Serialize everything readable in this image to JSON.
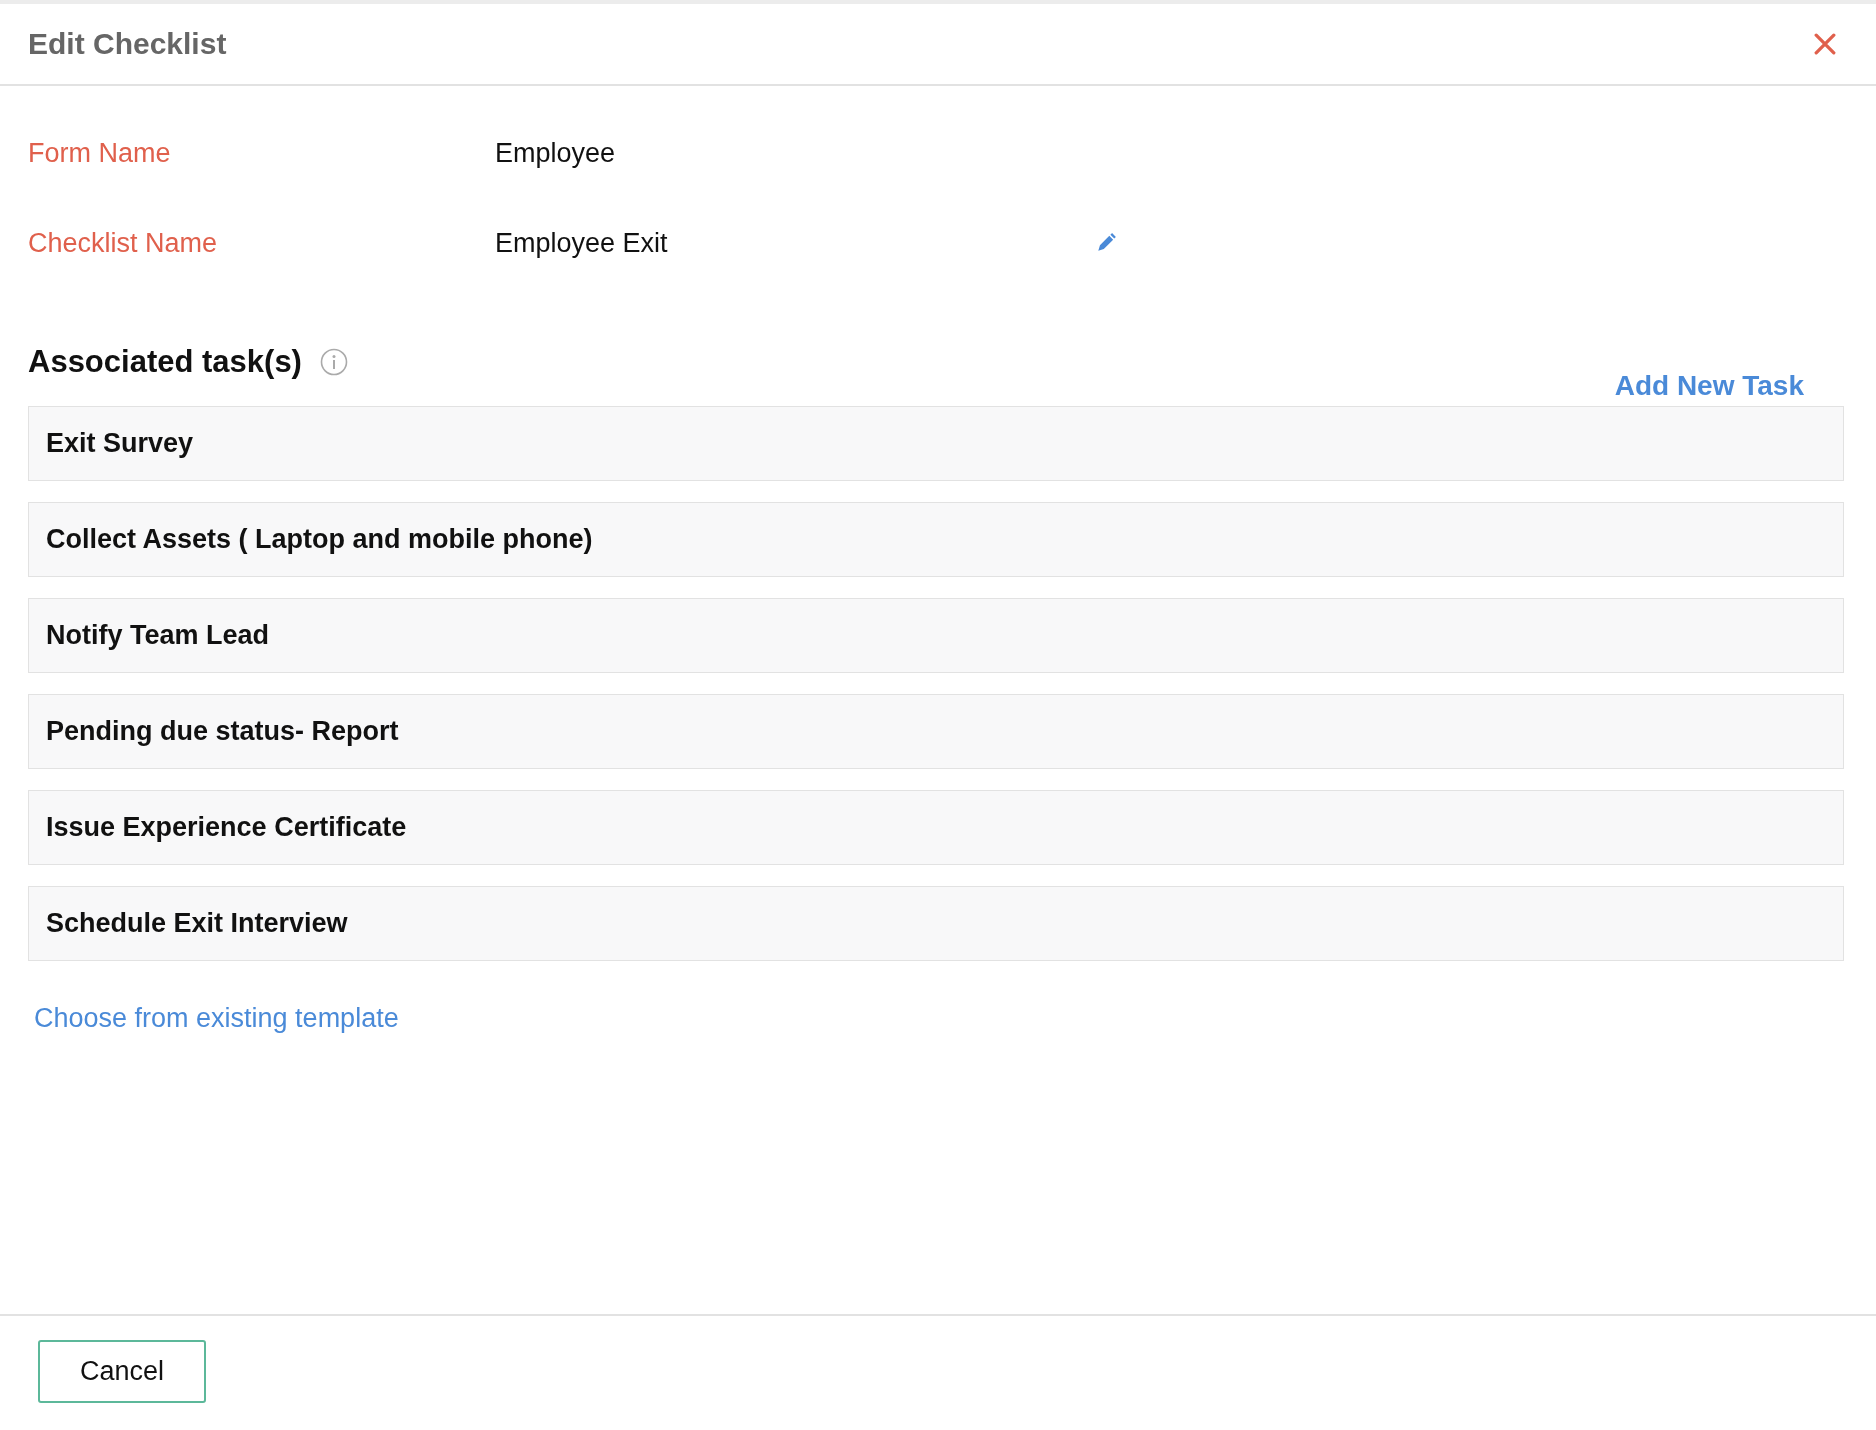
{
  "dialog": {
    "title": "Edit Checklist"
  },
  "fields": [
    {
      "label": "Form Name",
      "value": "Employee",
      "editable": false
    },
    {
      "label": "Checklist Name",
      "value": "Employee Exit",
      "editable": true
    }
  ],
  "tasks_section": {
    "heading": "Associated task(s)",
    "add_link": "Add New Task",
    "tasks": [
      "Exit Survey",
      "Collect Assets ( Laptop and mobile phone)",
      "Notify Team Lead",
      "Pending due status- Report",
      "Issue Experience Certificate",
      "Schedule Exit Interview"
    ],
    "template_link": "Choose from existing template"
  },
  "footer": {
    "buttons": [
      "Cancel"
    ]
  }
}
